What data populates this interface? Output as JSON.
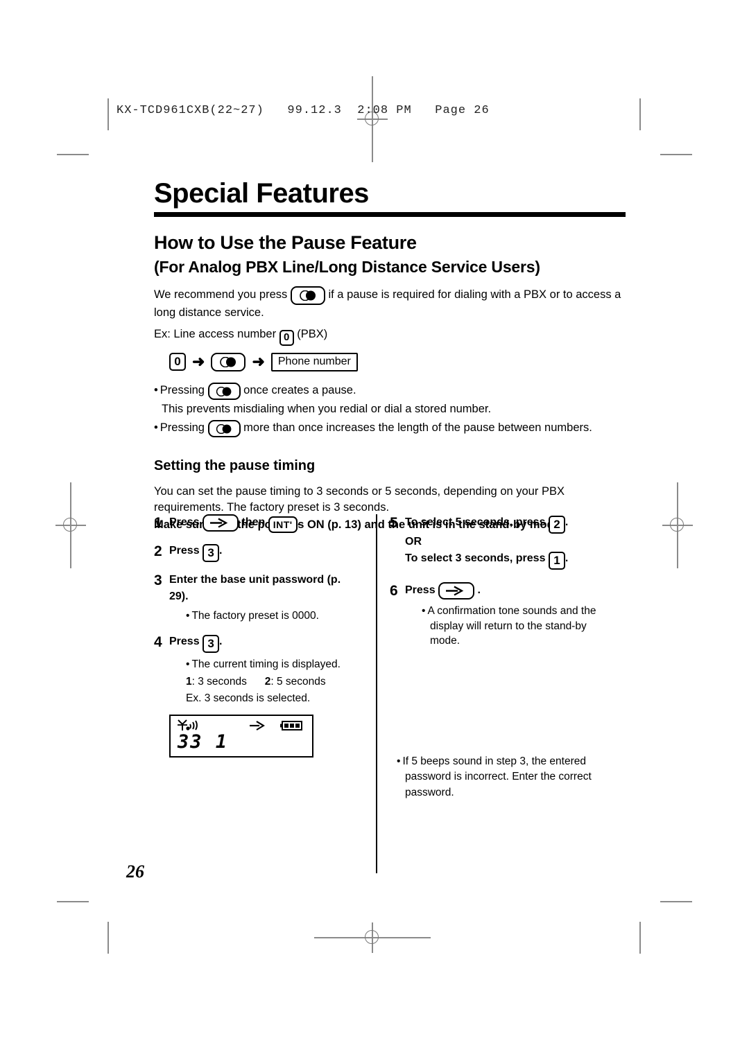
{
  "print_slug": {
    "text": "KX-TCD961CXB(22~27)   99.12.3  2:08 PM   Page 26"
  },
  "page_number": "26",
  "chapter_title": "Special Features",
  "section_title": "How to Use the Pause Feature",
  "section_subtitle": "(For Analog PBX Line/Long Distance Service Users)",
  "intro": {
    "part1": "We recommend you press",
    "part2": "if a pause is required for dialing with a PBX or to access a long distance service.",
    "example_label": "Ex: Line access number",
    "example_key": "0",
    "example_suffix": "(PBX)",
    "sequence": {
      "key1": "0",
      "arrow": "➜",
      "phone_label": "Phone number"
    }
  },
  "bullets": [
    {
      "pre": "Pressing",
      "post": "once creates a pause."
    },
    {
      "cont": "This prevents misdialing when you redial or dial a stored number."
    },
    {
      "pre": "Pressing",
      "post": "more than once increases the length of the pause between numbers."
    }
  ],
  "subhead": "Setting the pause timing",
  "intro2": {
    "line1": "You can set the pause timing to 3 seconds or 5 seconds, depending on your PBX requirements. The factory preset is 3 seconds.",
    "line2": "Make sure that the power is ON (p. 13) and the unit is in the stand-by mode."
  },
  "steps_left": [
    {
      "num": "1",
      "text_pre": "Press",
      "key1": "program-key",
      "text_mid": "then",
      "key2": "INT'",
      "text_post": "."
    },
    {
      "num": "2",
      "text_pre": "Press",
      "key": "3",
      "text_post": "."
    },
    {
      "num": "3",
      "text": "Enter the base unit password (p. 29).",
      "sub": "The factory preset is 0000."
    },
    {
      "num": "4",
      "text_pre": "Press",
      "key": "3",
      "text_post": ".",
      "sub": "The current timing is displayed.",
      "options": {
        "opt1_key": "1",
        "opt1_label": ": 3 seconds",
        "opt2_key": "2",
        "opt2_label": ": 5 seconds"
      },
      "example": "Ex. 3 seconds is selected."
    }
  ],
  "lcd": {
    "digits": "33  1",
    "icons": [
      "signal-icon",
      "arrow-icon",
      "battery-icon"
    ]
  },
  "steps_right": [
    {
      "num": "5",
      "line1_pre": "To select 5 seconds, press",
      "line1_key": "2",
      "line1_post": ".",
      "or": "OR",
      "line2_pre": "To select 3 seconds, press",
      "line2_key": "1",
      "line2_post": "."
    },
    {
      "num": "6",
      "text_pre": "Press",
      "key": "program-key",
      "text_post": ".",
      "sub": "A confirmation tone sounds and the display will return to the stand-by mode."
    }
  ],
  "right_note": "If 5 beeps sound in step 3, the entered password is incorrect. Enter the correct password."
}
